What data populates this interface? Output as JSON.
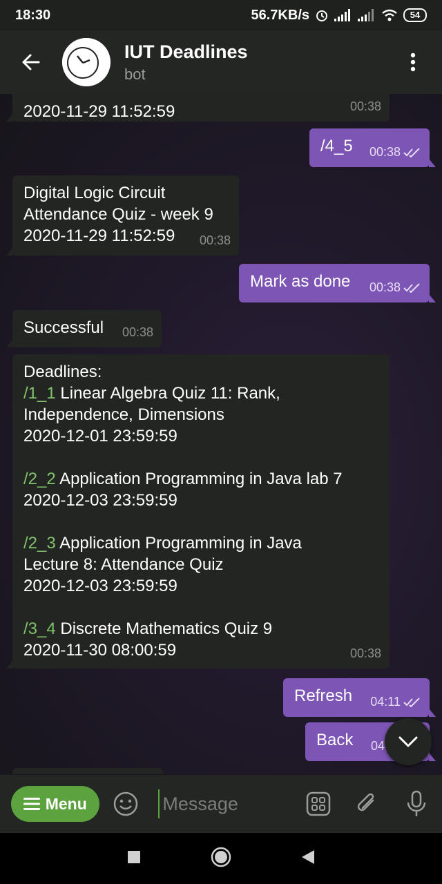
{
  "status_bar": {
    "time": "18:30",
    "speed": "56.7KB/s",
    "battery": "54"
  },
  "header": {
    "title": "IUT Deadlines",
    "subtitle": "bot"
  },
  "messages": [
    {
      "lines": [
        "2020-11-29 11:52:59"
      ],
      "time": "00:38"
    },
    {
      "text": "/4_5",
      "time": "00:38"
    },
    {
      "lines": [
        "Digital Logic Circuit",
        "Attendance Quiz - week 9",
        "2020-11-29 11:52:59"
      ],
      "time": "00:38"
    },
    {
      "text": "Mark as done",
      "time": "00:38"
    },
    {
      "text": "Successful",
      "time": "00:38"
    },
    {
      "header": "Deadlines:",
      "items": [
        {
          "cmd": "/1_1",
          "title": "Linear Algebra Quiz 11: Rank,",
          "title2": "Independence, Dimensions",
          "date": "2020-12-01 23:59:59"
        },
        {
          "cmd": "/2_2",
          "title": "Application Programming in Java lab 7",
          "date": "2020-12-03 23:59:59"
        },
        {
          "cmd": "/2_3",
          "title": "Application Programming in Java",
          "title2": "Lecture 8: Attendance Quiz",
          "date": "2020-12-03 23:59:59"
        },
        {
          "cmd": "/3_4",
          "title": "Discrete Mathematics Quiz 9",
          "date": "2020-11-30 08:00:59"
        }
      ],
      "time": "00:38"
    },
    {
      "text": "Refresh",
      "time": "04:11"
    },
    {
      "text": "Back",
      "time": "04:"
    }
  ],
  "input": {
    "menu_label": "Menu",
    "placeholder": "Message"
  },
  "colors": {
    "accent_green": "#5ca33f",
    "outgoing_bubble": "#7d55b5",
    "incoming_bubble": "#232523",
    "command_link": "#7fc46a"
  }
}
